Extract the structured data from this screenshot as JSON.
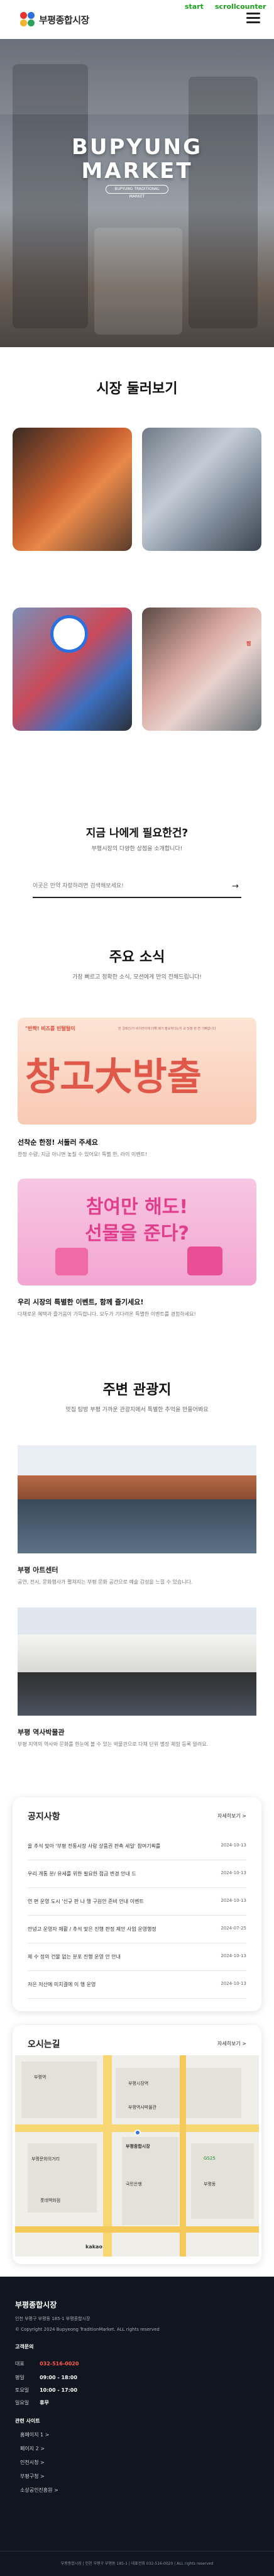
{
  "header": {
    "logo_text": "부평종합시장",
    "debug_start": "start",
    "debug_scroll": "scrollcounter"
  },
  "hero": {
    "title_line1": "BUPYUNG",
    "title_line2": "MARKET",
    "subtitle": "BUPYUNG TRADITIONAL MARKET"
  },
  "look": {
    "title": "시장 둘러보기",
    "floating_label": "찜"
  },
  "search": {
    "title": "지금 나에게 필요한건?",
    "subtitle": "부평시장의 다양한 상점을 소개합니다!",
    "placeholder": "이곳은 만약 자랑하려면 검색해보세요!",
    "arrow": "→"
  },
  "news": {
    "title": "주요 소식",
    "subtitle": "가장 빠르고 정확한 소식, 모션에게 만의 전해드립니다!",
    "items": [
      {
        "badge": "\"반짝! 비즈를 빈털털이",
        "small": "한 걸레인/가 비이러이에 더해 매기 필요하다는지 교 당첨 펀 연 기뻐합니다",
        "banner": "창고大방출",
        "title": "선착순 한정! 서둘러 주세요",
        "desc": "한정 수량, 지금 아니면 놓칠 수 있어요! 특별 한, 라이 이벤트!"
      },
      {
        "banner_line1": "참여만 해도!",
        "banner_line2": "선물을 준다?",
        "title": "우리 시장의 특별한 이벤트, 함께 즐기세요!",
        "desc": "다채로운 혜택과 즐거움이 가득합니다. 모두가 기다려온 특별한 이벤트를 경험하세요!"
      }
    ]
  },
  "tour": {
    "title": "주변 관광지",
    "subtitle": "맛집 탐방 부평 가까운 관광지에서 특별한 추억을 만들어봐요",
    "items": [
      {
        "title": "부평 아트센터",
        "desc": "공연, 전시, 문화행사가 펼쳐지는 부평 문화 공간으로 예술 감성을 느낄 수 있습니다."
      },
      {
        "title": "부평 역사박물관",
        "desc": "부평 지역의 역사와 문화를 한눈에 볼 수 있는 박물관으로 다채 단위 별장 체험 등록 알려요."
      }
    ]
  },
  "notice": {
    "title": "공지사항",
    "more": "자세히보기 >",
    "rows": [
      {
        "text": "올 추석 맞아 '부평 전통시장 사랑 상품권 판촉 세일' 참여기획를",
        "date": "2024-10-13"
      },
      {
        "text": "우리 개통 분/ 유세를 위한 필요한 점금 변경 안내 드",
        "date": "2024-10-13"
      },
      {
        "text": "연 편 운영 도시 '신규 판 나 행 구원안 준비 안내 이벤트",
        "date": "2024-10-13"
      },
      {
        "text": "안녕고 운영자 재활 / 추석 맞은 진행 판정 제안 사업 운영행정",
        "date": "2024-07-25"
      },
      {
        "text": "제 수 정의 건물 없는 분포 진행 운영 안 안내",
        "date": "2024-10-13"
      },
      {
        "text": "저은 저산에 미치결에 이 행 운영",
        "date": "2024-10-13"
      }
    ]
  },
  "map": {
    "title": "오시는길",
    "more": "자세히보기 >",
    "labels": [
      "부평역",
      "부평시장역",
      "부평역사박물관",
      "부평문화의거리",
      "GS25",
      "부평동",
      "부평종합시장",
      "국민은행",
      "롯데백화점",
      "kakao"
    ]
  },
  "footer": {
    "name": "부평종합시장",
    "address": "인천 부평구 부평동 185-1 부평종합시장",
    "copyright": "© Copyright 2024 Bupyeong TraditionMarket. ALL rights reserved",
    "hours_title": "고객문의",
    "phone_label": "대표",
    "phone": "032-516-0020",
    "rows": [
      {
        "k": "평일",
        "v": "09:00 - 18:00"
      },
      {
        "k": "토요일",
        "v": "10:00 - 17:00"
      },
      {
        "k": "일요일",
        "v": "휴무"
      }
    ],
    "related_title": "관련 사이트",
    "links": [
      "홈페이지 1 >",
      "페이지 2 >",
      "인천시청 >",
      "부평구청 >",
      "소상공인진흥원 >"
    ],
    "bottom_text": "부평종합시장 | 인천 부평구 부평동 185-1 | 대표전화 032-516-0020 | ALL rights reserved"
  },
  "colors": {
    "accent_red": "#e7332d",
    "accent_blue": "#2b6fe0",
    "footer_bg": "#10161f"
  }
}
